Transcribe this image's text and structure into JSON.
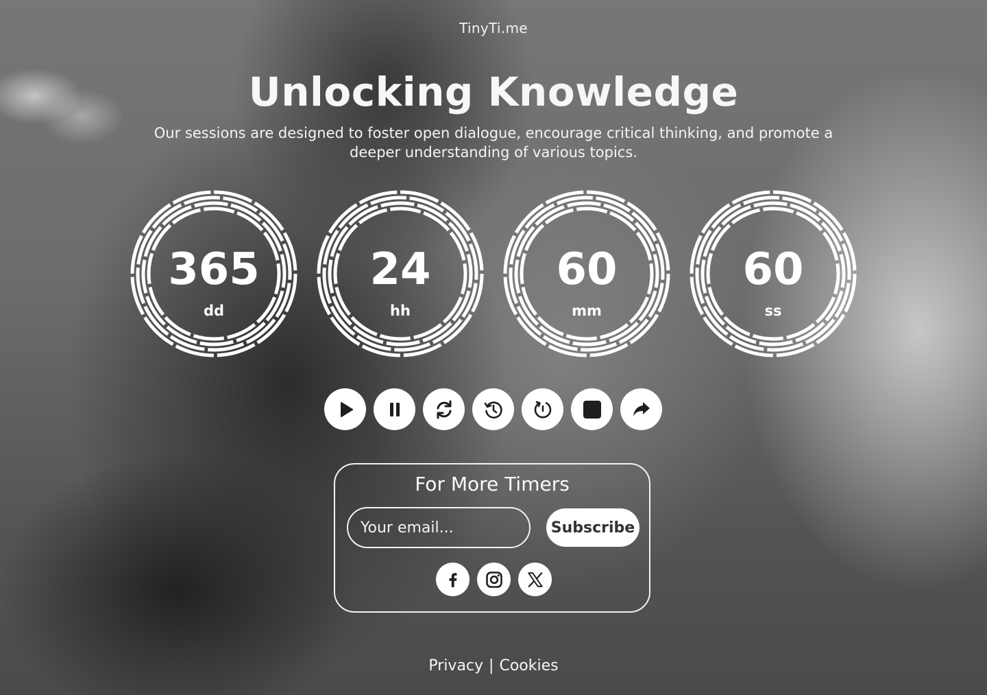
{
  "brand": "TinyTi.me",
  "hero": {
    "title": "Unlocking Knowledge",
    "subtitle": "Our sessions are designed to foster open dialogue, encourage critical thinking, and promote a deeper understanding of various topics."
  },
  "timer": [
    {
      "value": "365",
      "unit": "dd"
    },
    {
      "value": "24",
      "unit": "hh"
    },
    {
      "value": "60",
      "unit": "mm"
    },
    {
      "value": "60",
      "unit": "ss"
    }
  ],
  "controls": [
    {
      "name": "play-icon"
    },
    {
      "name": "pause-icon"
    },
    {
      "name": "refresh-icon"
    },
    {
      "name": "history-icon"
    },
    {
      "name": "restart-icon"
    },
    {
      "name": "stop-icon"
    },
    {
      "name": "share-icon"
    }
  ],
  "subscribe": {
    "title": "For More Timers",
    "email_placeholder": "Your email...",
    "button_label": "Subscribe"
  },
  "social": [
    "facebook-icon",
    "instagram-icon",
    "x-icon"
  ],
  "footer": {
    "privacy": "Privacy",
    "separator": "|",
    "cookies": "Cookies"
  },
  "colors": {
    "foreground": "#ffffff",
    "button_text": "#333333",
    "icon_dark": "#1e1e1e"
  }
}
